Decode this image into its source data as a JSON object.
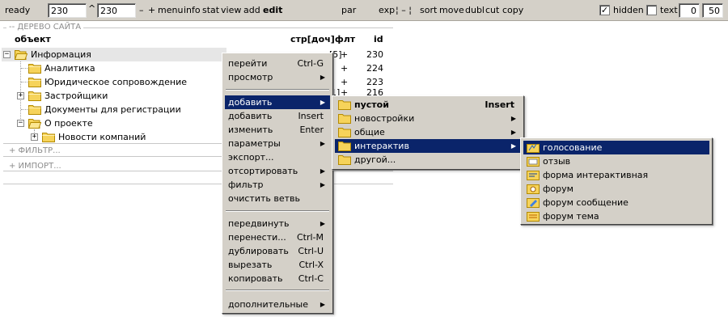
{
  "toolbar": {
    "status": "ready",
    "field1": "230",
    "field2": "230",
    "up_arrow": "^",
    "minus": "–",
    "plus": "+",
    "menu": "menu",
    "info": "info",
    "stat": "stat",
    "view": "view",
    "add": "add",
    "edit": "edit",
    "par": "par",
    "exp": "exp",
    "sep": "¦ – ¦",
    "sort": "sort",
    "move": "move",
    "dubl": "dubl",
    "cut": "cut",
    "copy": "copy",
    "hidden_label": "hidden",
    "hidden_checked": "✓",
    "text_label": "text",
    "num1": "0",
    "num2": "50"
  },
  "tree": {
    "section_title": "-- ДЕРЕВО САЙТА",
    "col_object": "объект",
    "col_meta": "стр[доч]флт",
    "col_id": "id",
    "rows": [
      {
        "label": "Информация",
        "meta": "[5]",
        "plus": "+",
        "id": "230"
      },
      {
        "label": "Аналитика",
        "plus": "+",
        "id": "224"
      },
      {
        "label": "Юридическое сопровождение",
        "plus": "+",
        "id": "223"
      },
      {
        "label": "Застройщики",
        "meta": "1]",
        "plus": "+",
        "id": "216"
      },
      {
        "label": "Документы для регистрации"
      },
      {
        "label": "О проекте"
      },
      {
        "label": "Новости компаний"
      }
    ],
    "filter_title": "+ ФИЛЬТР...",
    "import_title": "+ ИМПОРТ..."
  },
  "menu1": {
    "items": [
      {
        "label": "перейти",
        "shortcut": "Ctrl-G"
      },
      {
        "label": "просмотр",
        "arrow": "▶"
      },
      {
        "label": "добавить",
        "arrow": "▶"
      },
      {
        "label": "добавить",
        "shortcut": "Insert"
      },
      {
        "label": "изменить",
        "shortcut": "Enter"
      },
      {
        "label": "параметры",
        "arrow": "▶"
      },
      {
        "label": "экспорт..."
      },
      {
        "label": "отсортировать",
        "arrow": "▶"
      },
      {
        "label": "фильтр",
        "arrow": "▶"
      },
      {
        "label": "очистить ветвь"
      },
      {
        "label": "передвинуть",
        "arrow": "▶"
      },
      {
        "label": "перенести...",
        "shortcut": "Ctrl-M"
      },
      {
        "label": "дублировать",
        "shortcut": "Ctrl-U"
      },
      {
        "label": "вырезать",
        "shortcut": "Ctrl-X"
      },
      {
        "label": "копировать",
        "shortcut": "Ctrl-C"
      },
      {
        "label": "дополнительные",
        "arrow": "▶"
      }
    ]
  },
  "menu2": {
    "items": [
      {
        "label": "пустой",
        "shortcut": "Insert"
      },
      {
        "label": "новостройки",
        "arrow": "▶"
      },
      {
        "label": "общие",
        "arrow": "▶"
      },
      {
        "label": "интерактив",
        "arrow": "▶"
      },
      {
        "label": "другой..."
      }
    ]
  },
  "menu3": {
    "items": [
      {
        "label": "голосование",
        "icon": "vote-icon"
      },
      {
        "label": "отзыв",
        "icon": "feedback-icon"
      },
      {
        "label": "форма интерактивная",
        "icon": "form-icon"
      },
      {
        "label": "форум",
        "icon": "forum-icon"
      },
      {
        "label": "форум сообщение",
        "icon": "forum-message-icon"
      },
      {
        "label": "форум тема",
        "icon": "forum-topic-icon"
      }
    ]
  },
  "colors": {
    "menu_bg": "#d4d0c8",
    "highlight": "#0a246a",
    "folder_yellow": "#f0c800"
  }
}
